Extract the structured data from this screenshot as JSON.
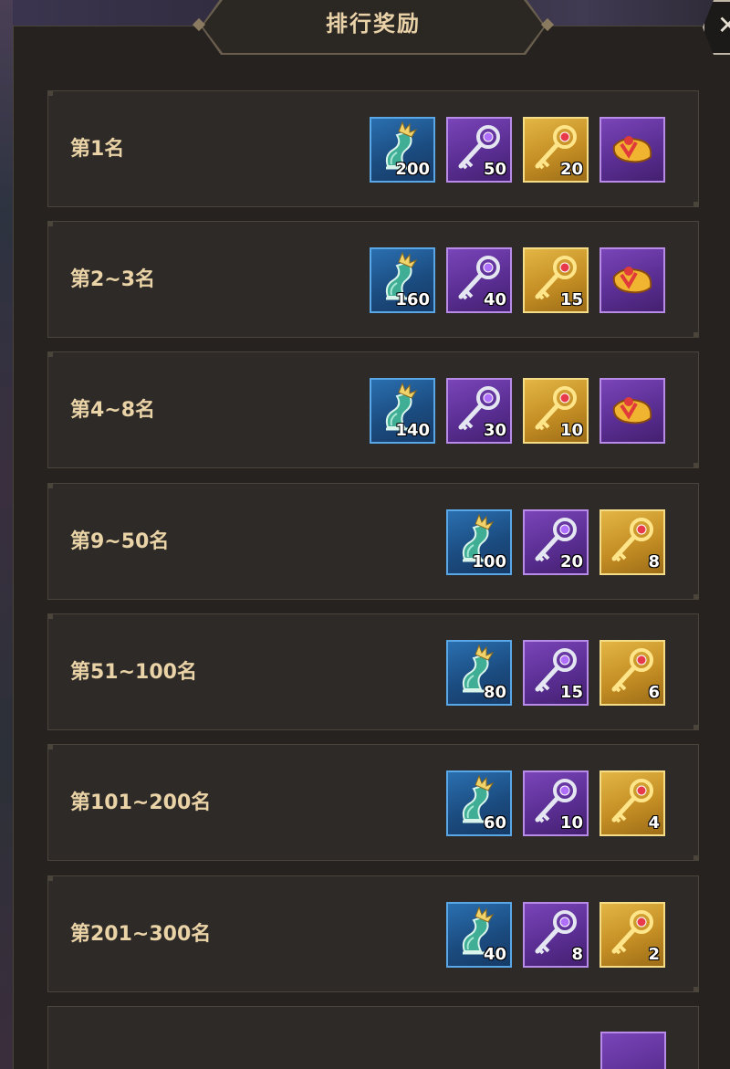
{
  "title": "排行奖励",
  "close_icon": "close-icon",
  "colors": {
    "title_text": "#e9d2a8",
    "rank_text": "#ead3a6",
    "blue_frame": "#5aa7e8",
    "purple_frame": "#b98be8",
    "gold_frame": "#f5dd88"
  },
  "rows": [
    {
      "rank": "第1名",
      "items": [
        {
          "icon": "scroll-icon",
          "rarity": "blue",
          "qty": "200"
        },
        {
          "icon": "silver-key-icon",
          "rarity": "purple",
          "qty": "50"
        },
        {
          "icon": "gold-key-icon",
          "rarity": "gold",
          "qty": "20"
        },
        {
          "icon": "gift-scroll-icon",
          "rarity": "purple",
          "qty": ""
        }
      ]
    },
    {
      "rank": "第2~3名",
      "items": [
        {
          "icon": "scroll-icon",
          "rarity": "blue",
          "qty": "160"
        },
        {
          "icon": "silver-key-icon",
          "rarity": "purple",
          "qty": "40"
        },
        {
          "icon": "gold-key-icon",
          "rarity": "gold",
          "qty": "15"
        },
        {
          "icon": "gift-scroll-icon",
          "rarity": "purple",
          "qty": ""
        }
      ]
    },
    {
      "rank": "第4~8名",
      "items": [
        {
          "icon": "scroll-icon",
          "rarity": "blue",
          "qty": "140"
        },
        {
          "icon": "silver-key-icon",
          "rarity": "purple",
          "qty": "30"
        },
        {
          "icon": "gold-key-icon",
          "rarity": "gold",
          "qty": "10"
        },
        {
          "icon": "gift-scroll-icon",
          "rarity": "purple",
          "qty": ""
        }
      ]
    },
    {
      "rank": "第9~50名",
      "items": [
        {
          "icon": "scroll-icon",
          "rarity": "blue",
          "qty": "100"
        },
        {
          "icon": "silver-key-icon",
          "rarity": "purple",
          "qty": "20"
        },
        {
          "icon": "gold-key-icon",
          "rarity": "gold",
          "qty": "8"
        }
      ]
    },
    {
      "rank": "第51~100名",
      "items": [
        {
          "icon": "scroll-icon",
          "rarity": "blue",
          "qty": "80"
        },
        {
          "icon": "silver-key-icon",
          "rarity": "purple",
          "qty": "15"
        },
        {
          "icon": "gold-key-icon",
          "rarity": "gold",
          "qty": "6"
        }
      ]
    },
    {
      "rank": "第101~200名",
      "items": [
        {
          "icon": "scroll-icon",
          "rarity": "blue",
          "qty": "60"
        },
        {
          "icon": "silver-key-icon",
          "rarity": "purple",
          "qty": "10"
        },
        {
          "icon": "gold-key-icon",
          "rarity": "gold",
          "qty": "4"
        }
      ]
    },
    {
      "rank": "第201~300名",
      "items": [
        {
          "icon": "scroll-icon",
          "rarity": "blue",
          "qty": "40"
        },
        {
          "icon": "silver-key-icon",
          "rarity": "purple",
          "qty": "8"
        },
        {
          "icon": "gold-key-icon",
          "rarity": "gold",
          "qty": "2"
        }
      ]
    }
  ]
}
